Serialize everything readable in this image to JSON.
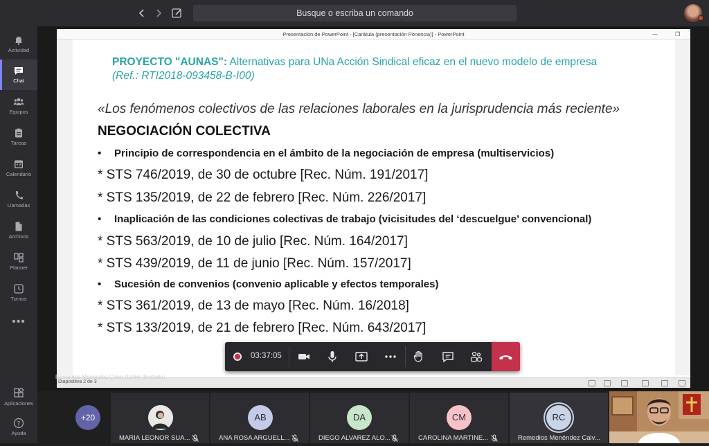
{
  "topbar": {
    "search_placeholder": "Busque o escriba un comando"
  },
  "rail": {
    "items": [
      {
        "label": "Actividad",
        "icon": "bell-icon"
      },
      {
        "label": "Chat",
        "icon": "chat-icon"
      },
      {
        "label": "Equipos",
        "icon": "teams-icon"
      },
      {
        "label": "Tareas",
        "icon": "tasks-icon"
      },
      {
        "label": "Calendario",
        "icon": "calendar-icon"
      },
      {
        "label": "Llamadas",
        "icon": "phone-icon"
      },
      {
        "label": "Archivos",
        "icon": "files-icon"
      },
      {
        "label": "Planner",
        "icon": "planner-icon"
      },
      {
        "label": "Turnos",
        "icon": "clock-icon"
      }
    ],
    "more": "•••",
    "apps_label": "Aplicaciones",
    "help_label": "Ayuda"
  },
  "powerpoint": {
    "window_title": "Presentación de PowerPoint - [Carátula (presentación Ponencia)] - PowerPoint",
    "slide_counter": "Diapositiva 2 de 3"
  },
  "slide": {
    "project_name": "PROYECTO \"AUNAS\":",
    "project_desc": " Alternativas para UNa Acción Sindical eficaz en el nuevo modelo de empresa",
    "project_ref": "(Ref.: RTI2018-093458-B-I00)",
    "quote": "«Los fenómenos colectivos de las relaciones laborales en la jurisprudencia más reciente»",
    "heading": "NEGOCIACIÓN COLECTIVA",
    "bullets": [
      "Principio de correspondencia en el ámbito de la negociación de empresa (multiservicios)",
      "Inaplicación de las condiciones colectivas de trabajo (vicisitudes del ‘descuelgue’ convencional)",
      "Sucesión de convenios (convenio aplicable y efectos temporales)"
    ],
    "cases": [
      "* STS 746/2019, de 30 de octubre [Rec. Núm. 191/2017]",
      "* STS 135/2019, de 22 de febrero [Rec. Núm. 226/2017]",
      "* STS 563/2019, de 10 de julio [Rec. Núm. 164/2017]",
      "* STS 439/2019, de 11 de junio [Rec. Núm. 157/2017]",
      "* STS 361/2019, de 13 de mayo [Rec. Núm. 16/2018]",
      "* STS 133/2019, de 21 de febrero [Rec. Núm. 643/2017]"
    ]
  },
  "call": {
    "timer": "03:37:05",
    "presenter": "Remedios Menéndez Calvo (UAH) (Invitado)",
    "more_participants": "+20",
    "participants": [
      {
        "initials": "",
        "name": "MARIA LEONOR SUA...",
        "color": "#cfcfcf"
      },
      {
        "initials": "AB",
        "name": "ANA ROSA ARGUELL...",
        "color": "#c5cae9"
      },
      {
        "initials": "DA",
        "name": "DIEGO ALVAREZ ALO...",
        "color": "#c8e6c9"
      },
      {
        "initials": "CM",
        "name": "CAROLINA MARTINE...",
        "color": "#f8c3c7"
      },
      {
        "initials": "RC",
        "name": "Remedios Menéndez Calv...",
        "color": "#c9d4e6"
      }
    ],
    "colors": {
      "accent": "#6264a7",
      "hangup": "#c4314b",
      "slide_title": "#2aa4a6"
    }
  }
}
